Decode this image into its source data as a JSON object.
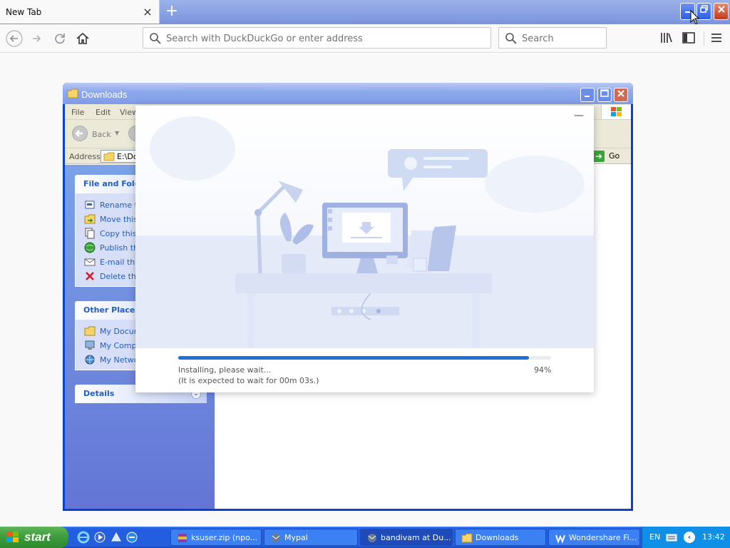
{
  "browser": {
    "tab_title": "New Tab",
    "tab_close": "×",
    "new_tab": "+",
    "url_placeholder": "Search with DuckDuckGo or enter address",
    "search_placeholder": "Search"
  },
  "explorer": {
    "title": "Downloads",
    "menu": [
      "File",
      "Edit",
      "View"
    ],
    "back_label": "Back",
    "address_label": "Address",
    "address_value": "E:\\Doc",
    "go_label": "Go",
    "file_tasks": {
      "title": "File and Folde",
      "items": [
        "Rename th",
        "Move this f",
        "Copy this f",
        "Publish this",
        "E-mail this",
        "Delete this"
      ]
    },
    "other_places": {
      "title": "Other Places",
      "items": [
        "My Docume",
        "My Comput",
        "My Networ"
      ]
    },
    "details": {
      "title": "Details"
    }
  },
  "installer": {
    "minimize": "—",
    "status": "Installing, please wait...",
    "eta": "(It is expected to wait for 00m 03s.)",
    "percent_label": "94%",
    "progress": 0.94
  },
  "taskbar": {
    "start_label": "start",
    "tasks": [
      {
        "label": "ksuser.zip (npo...",
        "icon": "winrar-icon"
      },
      {
        "label": "Mypal",
        "icon": "mypal-icon"
      },
      {
        "label": "bandivam at Du...",
        "icon": "browser-icon"
      },
      {
        "label": "Downloads",
        "icon": "folder-icon"
      },
      {
        "label": "Wondershare Fi...",
        "icon": "wondershare-icon"
      }
    ],
    "lang": "EN",
    "clock": "13:42"
  }
}
